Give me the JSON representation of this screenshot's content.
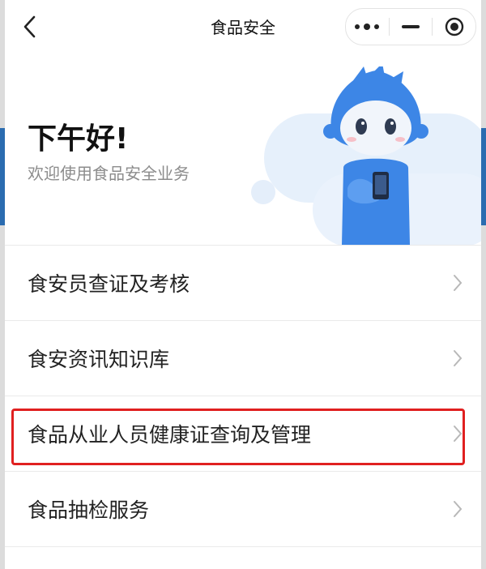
{
  "nav": {
    "title": "食品安全",
    "icons": [
      "back-icon",
      "more-dots-icon",
      "minimize-icon",
      "close-target-icon"
    ]
  },
  "hero": {
    "greeting": "下午好!",
    "welcome": "欢迎使用食品安全业务"
  },
  "menu": {
    "items": [
      {
        "label": "食安员查证及考核"
      },
      {
        "label": "食安资讯知识库"
      },
      {
        "label": "食品从业人员健康证查询及管理",
        "highlighted": true
      },
      {
        "label": "食品抽检服务"
      }
    ]
  },
  "colors": {
    "highlight": "#e02020",
    "mascot": "#4a90e2"
  }
}
